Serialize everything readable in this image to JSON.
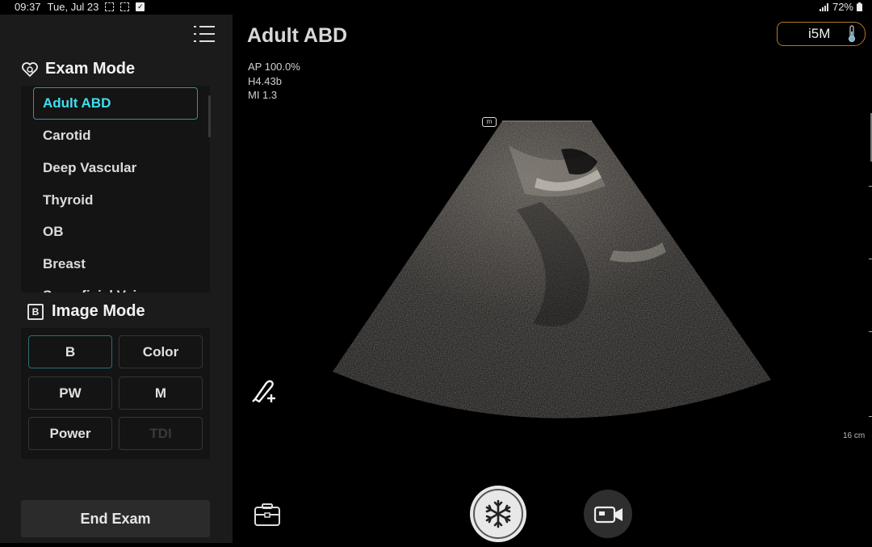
{
  "status_bar": {
    "time": "09:37",
    "date": "Tue, Jul 23",
    "battery": "72%"
  },
  "sidebar": {
    "exam_mode_title": "Exam Mode",
    "exam_items": [
      {
        "label": "Adult ABD",
        "active": true
      },
      {
        "label": "Carotid"
      },
      {
        "label": "Deep Vascular"
      },
      {
        "label": "Thyroid"
      },
      {
        "label": "OB"
      },
      {
        "label": "Breast"
      },
      {
        "label": "Superficial Vein"
      }
    ],
    "image_mode_title": "Image Mode",
    "image_mode_badge": "B",
    "image_modes": [
      {
        "label": "B",
        "active": true
      },
      {
        "label": "Color"
      },
      {
        "label": "PW"
      },
      {
        "label": "M"
      },
      {
        "label": "Power"
      },
      {
        "label": "TDI",
        "disabled": true
      }
    ],
    "end_exam_label": "End Exam"
  },
  "main": {
    "preset_title": "Adult ABD",
    "params": [
      "AP 100.0%",
      "H4.43b",
      "MI 1.3"
    ],
    "probe_label": "i5M",
    "orientation_marker": "m",
    "depth_label": "16 cm"
  },
  "toolbar": {
    "freeze_icon": "snowflake-icon",
    "camera_icon": "camera-icon",
    "briefcase_icon": "briefcase-icon",
    "annotate_icon": "pen-plus-icon"
  }
}
